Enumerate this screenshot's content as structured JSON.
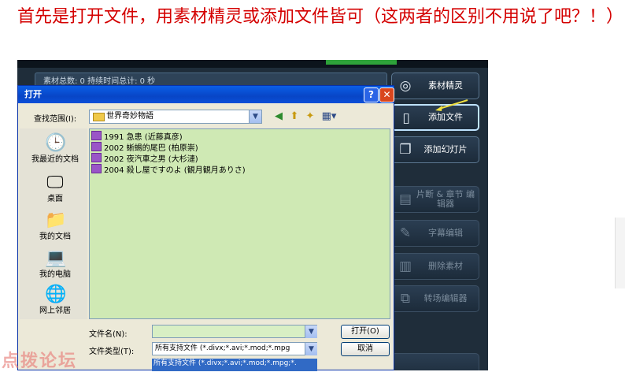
{
  "caption": "首先是打开文件，用素材精灵或添加文件皆可（这两者的区别不用说了吧？！）",
  "app": {
    "info_text": "素材总数: 0    持续时间总计: 0 秒",
    "buttons": [
      {
        "label": "素材精灵",
        "icon": "disc-icon",
        "enabled": true
      },
      {
        "label": "添加文件",
        "icon": "file-icon",
        "enabled": true,
        "selected": true
      },
      {
        "label": "添加幻灯片",
        "icon": "slideshow-icon",
        "enabled": true
      },
      {
        "label": "片断 & 章节 编辑器",
        "icon": "segment-icon",
        "enabled": false
      },
      {
        "label": "字幕编辑",
        "icon": "subtitle-icon",
        "enabled": false
      },
      {
        "label": "删除素材",
        "icon": "trash-icon",
        "enabled": false
      },
      {
        "label": "转场编辑器",
        "icon": "transition-icon",
        "enabled": false
      }
    ],
    "arrow_color": "#f0e040"
  },
  "dialog": {
    "title": "打开",
    "help_label": "?",
    "close_label": "✕",
    "look_in_label": "查找范围(I):",
    "look_in_value": "世界奇妙物語",
    "places": [
      {
        "label": "我最近的文档",
        "icon": "recent-documents-icon"
      },
      {
        "label": "桌面",
        "icon": "desktop-icon"
      },
      {
        "label": "我的文档",
        "icon": "my-documents-icon"
      },
      {
        "label": "我的电脑",
        "icon": "my-computer-icon"
      },
      {
        "label": "网上邻居",
        "icon": "network-icon"
      }
    ],
    "files": [
      "1991 急患 (近藤真彦)",
      "2002 蜥蜴的尾巴 (柏原崇)",
      "2002 夜汽車之男 (大杉漣)",
      "2004 殺し屋ですのよ (観月観月ありさ)"
    ],
    "file_name_label": "文件名(N):",
    "file_name_value": "",
    "file_type_label": "文件类型(T):",
    "file_type_value": "所有支持文件 (*.divx;*.avi;*.mod;*.mpg",
    "file_type_option": "所有支持文件 (*.divx;*.avi;*.mod;*.mpg;*.",
    "open_button": "打开(O)",
    "cancel_button": "取消"
  },
  "watermark": "点拨论坛",
  "colors": {
    "caption": "#d40000",
    "file_list_bg": "#cfe9b4",
    "titlebar": "#0845c6",
    "app_bg": "#1f2d3a"
  }
}
